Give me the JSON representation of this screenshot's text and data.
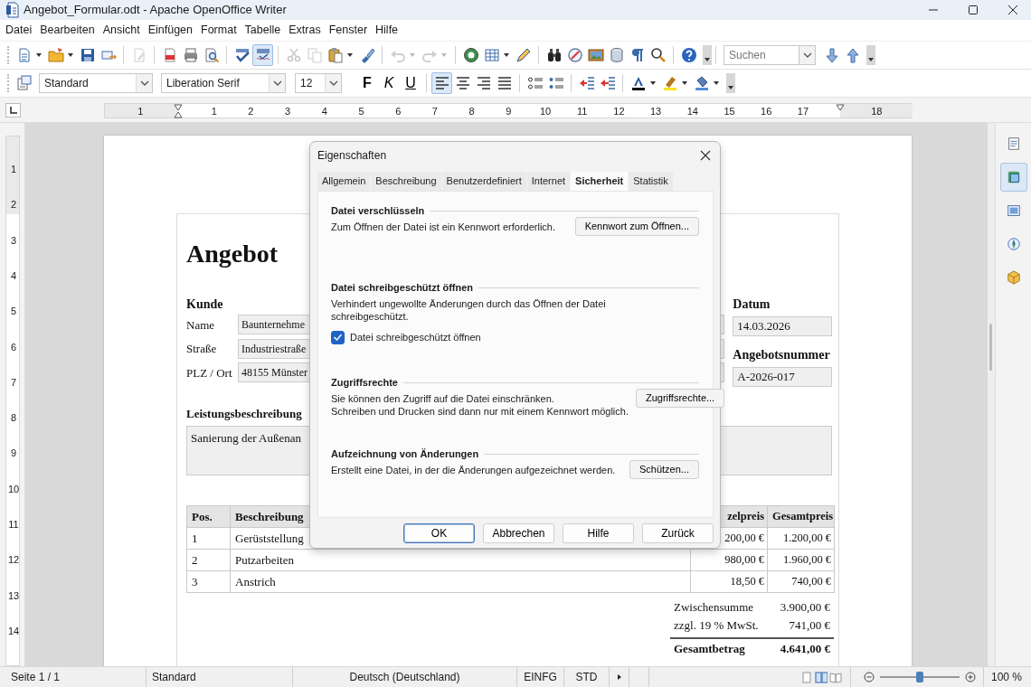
{
  "window": {
    "title": "Angebot_Formular.odt - Apache OpenOffice Writer"
  },
  "menu": [
    "Datei",
    "Bearbeiten",
    "Ansicht",
    "Einfügen",
    "Format",
    "Tabelle",
    "Extras",
    "Fenster",
    "Hilfe"
  ],
  "standard_toolbar": {
    "buttons": [
      {
        "kind": "new",
        "menu": true
      },
      {
        "kind": "open",
        "menu": true
      },
      {
        "kind": "save"
      },
      {
        "kind": "email"
      },
      {
        "kind": "separator"
      },
      {
        "kind": "edit",
        "disabled": true
      },
      {
        "kind": "separator"
      },
      {
        "kind": "pdf"
      },
      {
        "kind": "print"
      },
      {
        "kind": "preview"
      },
      {
        "kind": "separator"
      },
      {
        "kind": "spellcheck"
      },
      {
        "kind": "autospell",
        "selected": true
      },
      {
        "kind": "separator"
      },
      {
        "kind": "cut",
        "disabled": true
      },
      {
        "kind": "copy",
        "disabled": true
      },
      {
        "kind": "paste",
        "menu": true
      },
      {
        "kind": "clone"
      },
      {
        "kind": "separator"
      },
      {
        "kind": "undo",
        "disabled": true,
        "menu": true
      },
      {
        "kind": "redo",
        "disabled": true,
        "menu": true
      },
      {
        "kind": "separator"
      },
      {
        "kind": "navigator"
      },
      {
        "kind": "table",
        "menu": true
      },
      {
        "kind": "draw"
      },
      {
        "kind": "separator"
      },
      {
        "kind": "find"
      },
      {
        "kind": "gallery"
      },
      {
        "kind": "image"
      },
      {
        "kind": "database"
      },
      {
        "kind": "pilcrow"
      },
      {
        "kind": "zoom"
      },
      {
        "kind": "separator"
      },
      {
        "kind": "help"
      }
    ]
  },
  "find_toolbar": {
    "placeholder": "Suchen"
  },
  "formatting_toolbar": {
    "paragraph_style": "Standard",
    "font_name": "Liberation Serif",
    "font_size": "12",
    "buttons": [
      {
        "kind": "bold",
        "label": "F"
      },
      {
        "kind": "italic",
        "label": "K"
      },
      {
        "kind": "underline",
        "label": "U"
      },
      {
        "kind": "separator"
      },
      {
        "kind": "align_left",
        "selected": true
      },
      {
        "kind": "align_center",
        "selected": false
      },
      {
        "kind": "align_right",
        "selected": false
      },
      {
        "kind": "justify",
        "selected": false
      },
      {
        "kind": "separator"
      },
      {
        "kind": "numbering"
      },
      {
        "kind": "bullets"
      },
      {
        "kind": "separator"
      },
      {
        "kind": "outdent"
      },
      {
        "kind": "indent"
      },
      {
        "kind": "separator"
      },
      {
        "kind": "font_color",
        "menu": true
      },
      {
        "kind": "highlight",
        "menu": true
      },
      {
        "kind": "background",
        "menu": true
      }
    ]
  },
  "ruler": {
    "horizontal": [
      "1",
      "1",
      "2",
      "3",
      "4",
      "5",
      "6",
      "7",
      "8",
      "9",
      "10",
      "11",
      "12",
      "13",
      "14",
      "15",
      "16",
      "17",
      "18"
    ],
    "vertical": [
      "1",
      "2",
      "3",
      "4",
      "5",
      "6",
      "7",
      "8",
      "9",
      "10",
      "11",
      "12",
      "13",
      "14"
    ]
  },
  "document": {
    "title": "Angebot",
    "customer": {
      "heading": "Kunde",
      "fields": [
        {
          "label": "Name",
          "value": "Baunternehme"
        },
        {
          "label": "Straße",
          "value": "Industriestraße"
        },
        {
          "label": "PLZ / Ort",
          "value": "48155 Münster"
        }
      ]
    },
    "date": {
      "label": "Datum",
      "value": "14.03.2026"
    },
    "offer_number": {
      "label": "Angebotsnummer",
      "value": "A-2026-017"
    },
    "description": {
      "heading": "Leistungsbeschreibung",
      "value": "Sanierung der Außenan"
    },
    "items_table": {
      "columns": [
        "Pos.",
        "Beschreibung",
        "zelpreis",
        "Gesamtpreis"
      ],
      "rows": [
        [
          "1",
          "Gerüststellung",
          "200,00 €",
          "1.200,00 €"
        ],
        [
          "2",
          "Putzarbeiten",
          "980,00 €",
          "1.960,00 €"
        ],
        [
          "3",
          "Anstrich",
          "18,50 €",
          "740,00 €"
        ]
      ]
    },
    "totals": [
      {
        "kind": "line",
        "label": "Zwischensumme",
        "value": "3.900,00 €"
      },
      {
        "kind": "line",
        "label": "zzgl. 19 % MwSt.",
        "value": "741,00 €"
      },
      {
        "kind": "total",
        "label": "Gesamtbetrag",
        "value": "4.641,00 €"
      }
    ]
  },
  "dialog": {
    "title": "Eigenschaften",
    "tabs": [
      {
        "label": "Allgemein",
        "selected": false
      },
      {
        "label": "Beschreibung",
        "selected": false
      },
      {
        "label": "Benutzerdefiniert",
        "selected": false
      },
      {
        "label": "Internet",
        "selected": false
      },
      {
        "label": "Sicherheit",
        "selected": true
      },
      {
        "label": "Statistik",
        "selected": false
      }
    ],
    "sections": [
      {
        "heading": "Datei verschlüsseln",
        "text": "Zum Öffnen der Datei ist ein Kennwort erforderlich.",
        "button": "Kennwort zum Öffnen..."
      },
      {
        "heading": "Datei schreibgeschützt öffnen",
        "text": "Verhindert ungewollte Änderungen durch das Öffnen der Datei\nschreibgeschützt.",
        "checkbox": {
          "label": "Datei schreibgeschützt öffnen",
          "checked": true
        }
      },
      {
        "heading": "Zugriffsrechte",
        "text": "Sie können den Zugriff auf die Datei einschränken.\nSchreiben und Drucken sind dann nur mit einem Kennwort möglich.",
        "button": "Zugriffsrechte..."
      },
      {
        "heading": "Aufzeichnung von Änderungen",
        "text": "Erstellt eine Datei, in der die Änderungen aufgezeichnet werden.",
        "button": "Schützen..."
      }
    ],
    "buttons": [
      {
        "label": "OK",
        "default": true
      },
      {
        "label": "Abbrechen",
        "default": false
      },
      {
        "label": "Hilfe",
        "default": false
      },
      {
        "label": "Zurück",
        "default": false
      }
    ]
  },
  "sidebar": {
    "tabs": [
      {
        "kind": "properties",
        "selected": false
      },
      {
        "kind": "styles",
        "selected": true
      },
      {
        "kind": "gallery",
        "selected": false
      },
      {
        "kind": "navigator",
        "selected": false
      },
      {
        "kind": "functions",
        "selected": false
      }
    ]
  },
  "status_bar": {
    "page": "Seite 1 / 1",
    "style": "Standard",
    "language": "Deutsch (Deutschland)",
    "insert_mode": "EINFG",
    "selection_mode": "STD",
    "views": [
      {
        "kind": "single",
        "selected": false
      },
      {
        "kind": "multi",
        "selected": true
      },
      {
        "kind": "book",
        "selected": false
      }
    ],
    "zoom": {
      "level": 0.5,
      "reading": "100 %"
    }
  }
}
